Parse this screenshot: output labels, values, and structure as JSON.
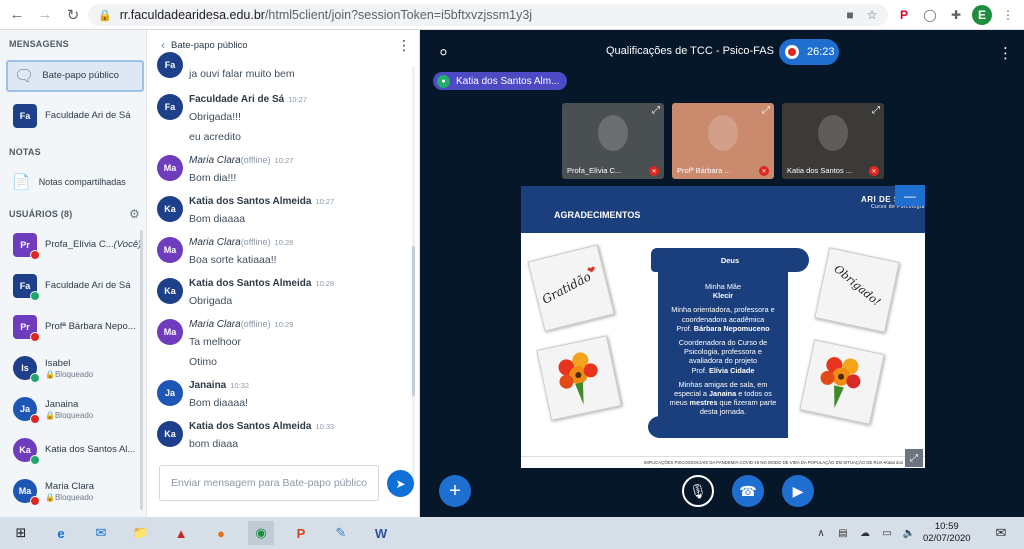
{
  "browser": {
    "url_host": "rr.faculdadearidesa.edu.br",
    "url_path": "/html5client/join?sessionToken=i5bftxvzjssm1y3j",
    "profile_initial": "E"
  },
  "sidebar": {
    "messages_header": "MENSAGENS",
    "public_chat": "Bate-papo público",
    "faculdade_chat": {
      "initials": "Fa",
      "name": "Faculdade Ari de Sá"
    },
    "notes_header": "NOTAS",
    "shared_notes": "Notas compartilhadas",
    "users_header": "USUÁRIOS (8)",
    "users": [
      {
        "initials": "Pr",
        "name": "Profa_Elívia C...",
        "you": "(Você)",
        "sub": "",
        "color": "#6e3cbc"
      },
      {
        "initials": "Fa",
        "name": "Faculdade Ari de Sá",
        "sub": "",
        "color": "#1e3f8a"
      },
      {
        "initials": "Pr",
        "name": "Profª Bárbara Nepo...",
        "sub": "",
        "color": "#6e3cbc"
      },
      {
        "initials": "Is",
        "name": "Isabel",
        "sub": "Bloqueado",
        "color": "#1e3f8a"
      },
      {
        "initials": "Ja",
        "name": "Janaina",
        "sub": "Bloqueado",
        "color": "#1e56b5"
      },
      {
        "initials": "Ka",
        "name": "Katia dos Santos Al...",
        "sub": "",
        "color": "#6e3cbc"
      },
      {
        "initials": "Ma",
        "name": "Maria Clara",
        "sub": "Bloqueado",
        "color": "#1e56b5"
      }
    ]
  },
  "chat": {
    "back_label": "Bate-papo público",
    "messages": [
      {
        "initials": "Fa",
        "name": "",
        "time": "",
        "offline": "",
        "lines": [
          "ja ouvi falar muito bem"
        ],
        "color": "#1e3f8a"
      },
      {
        "initials": "Fa",
        "name": "Faculdade Ari de Sá",
        "time": "10:27",
        "offline": "",
        "lines": [
          "Obrigada!!!",
          "eu acredito"
        ],
        "color": "#1e3f8a"
      },
      {
        "initials": "Ma",
        "name": "Maria Clara",
        "time": "10:27",
        "offline": "(offline)",
        "lines": [
          "Bom dia!!!"
        ],
        "color": "#6e3cbc"
      },
      {
        "initials": "Ka",
        "name": "Katia dos Santos Almeida",
        "time": "10:27",
        "offline": "",
        "lines": [
          "Bom diaaaa"
        ],
        "color": "#1e3f8a"
      },
      {
        "initials": "Ma",
        "name": "Maria Clara",
        "time": "10:28",
        "offline": "(offline)",
        "lines": [
          "Boa sorte katiaaa!!"
        ],
        "color": "#6e3cbc"
      },
      {
        "initials": "Ka",
        "name": "Katia dos Santos Almeida",
        "time": "10:28",
        "offline": "",
        "lines": [
          "Obrigada"
        ],
        "color": "#1e3f8a"
      },
      {
        "initials": "Ma",
        "name": "Maria Clara",
        "time": "10:29",
        "offline": "(offline)",
        "lines": [
          "Ta melhoor",
          "Otimo"
        ],
        "color": "#6e3cbc"
      },
      {
        "initials": "Ja",
        "name": "Janaina",
        "time": "10:32",
        "offline": "",
        "lines": [
          "Bom diaaaa!"
        ],
        "color": "#1e56b5"
      },
      {
        "initials": "Ka",
        "name": "Katia dos Santos Almeida",
        "time": "10:33",
        "offline": "",
        "lines": [
          "bom diaaa"
        ],
        "color": "#1e3f8a"
      }
    ],
    "input_placeholder": "Enviar mensagem para Bate-papo público"
  },
  "meeting": {
    "title": "Qualificações de TCC - Psico-FAS",
    "timer": "26:23",
    "talker": "Katia dos Santos Alm...",
    "cams": [
      {
        "label": "Profa_Elívia C...",
        "bg": "#4a4f52"
      },
      {
        "label": "Profª Bárbara ...",
        "bg": "#c98a6e"
      },
      {
        "label": "Katia dos Santos ...",
        "bg": "#3c3a38"
      }
    ]
  },
  "slide": {
    "title": "AGRADECIMENTOS",
    "logo": "ARI DE SÁ",
    "logo_sub": "Curso de Psicologia",
    "scroll_head": "Deus",
    "lines": [
      "Minha Mãe",
      "Klecir",
      "",
      "Minha orientadora, professora e",
      "coordenadora acadêmica",
      "Prof. Bárbara Nepomuceno",
      "",
      "Coordenadora do Curso de",
      "Psicologia, professora e",
      "avaliadora do projeto",
      "Prof. Elívia Cidade",
      "",
      "Minhas amigas de sala, em",
      "especial a Janaina e todos os",
      "meus mestres que fizeram parte",
      "desta jornada."
    ],
    "card_gratidao": "Gratidão",
    "card_obrigado": "Obrigado!",
    "footer": "IMPLICAÇÕES PSICOSSOCIAIS DA PANDEMIA COVID-19 NO MODO DE VIDA DA POPULAÇÃO EM SITUAÇÃO DE RUA  •Katia dos"
  },
  "taskbar": {
    "time": "10:59",
    "date": "02/07/2020"
  },
  "colors": {
    "accent": "#1f6fd1",
    "main_bg": "#06172a",
    "slide_blue": "#1b3f7c"
  }
}
